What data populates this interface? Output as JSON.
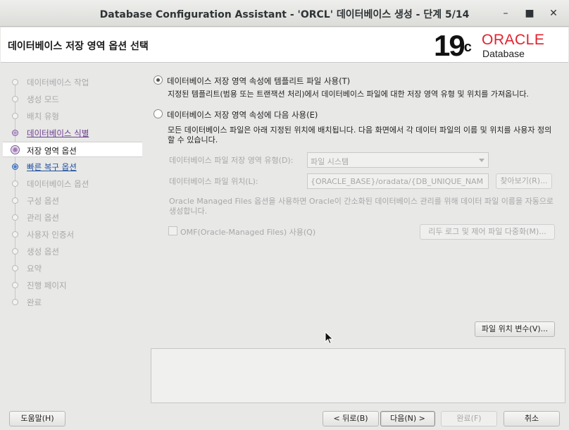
{
  "window": {
    "title": "Database Configuration Assistant - 'ORCL' 데이터베이스 생성 - 단계 5/14",
    "minimize_icon": "minimize-icon",
    "maximize_icon": "maximize-icon",
    "close_icon": "close-icon"
  },
  "header": {
    "heading": "데이터베이스 저장 영역 옵션 선택",
    "logo_version": "19",
    "logo_sup": "c",
    "logo_brand": "ORACLE",
    "logo_product": "Database"
  },
  "nav": {
    "items": [
      {
        "label": "데이터베이스 작업",
        "state": "disabled"
      },
      {
        "label": "생성 모드",
        "state": "disabled"
      },
      {
        "label": "배치 유형",
        "state": "disabled"
      },
      {
        "label": "데이터베이스 식별",
        "state": "visited"
      },
      {
        "label": "저장 영역 옵션",
        "state": "current"
      },
      {
        "label": "빠른 복구 옵션",
        "state": "link"
      },
      {
        "label": "데이터베이스 옵션",
        "state": "disabled"
      },
      {
        "label": "구성 옵션",
        "state": "disabled"
      },
      {
        "label": "관리 옵션",
        "state": "disabled"
      },
      {
        "label": "사용자 인증서",
        "state": "disabled"
      },
      {
        "label": "생성 옵션",
        "state": "disabled"
      },
      {
        "label": "요약",
        "state": "disabled"
      },
      {
        "label": "진행 페이지",
        "state": "disabled"
      },
      {
        "label": "완료",
        "state": "disabled"
      }
    ]
  },
  "main": {
    "option_template": {
      "label": "데이터베이스 저장 영역 속성에 템플리트 파일 사용(T)",
      "selected": true,
      "description": "지정된 템플리트(범용 또는 트랜잭션 처리)에서 데이터베이스 파일에 대한 저장 영역 유형 및 위치를 가져옵니다."
    },
    "option_custom": {
      "label": "데이터베이스 저장 영역 속성에 다음 사용(E)",
      "selected": false,
      "description": "모든 데이터베이스 파일은 아래 지정된 위치에 배치됩니다. 다음 화면에서 각 데이터 파일의 이름 및 위치를 사용자 정의할 수 있습니다."
    },
    "storage_type_label": "데이터베이스 파일 저장 영역 유형(D):",
    "storage_type_value": "파일 시스템",
    "file_location_label": "데이터베이스 파일 위치(L):",
    "file_location_value": "{ORACLE_BASE}/oradata/{DB_UNIQUE_NAM",
    "browse_button": "찾아보기(R)...",
    "omf_note": "Oracle Managed Files 옵션을 사용하면 Oracle이 간소화된 데이터베이스 관리를 위해 데이터 파일 이름을 자동으로 생성합니다.",
    "omf_checkbox_label": "OMF(Oracle-Managed Files) 사용(Q)",
    "omf_checked": false,
    "multiplex_button": "리두 로그 및 제어 파일 다중화(M)...",
    "file_location_vars_button": "파일 위치 변수(V)..."
  },
  "footer": {
    "help": "도움말(H)",
    "back": "< 뒤로(B)",
    "next": "다음(N) >",
    "finish": "완료(F)",
    "cancel": "취소"
  }
}
